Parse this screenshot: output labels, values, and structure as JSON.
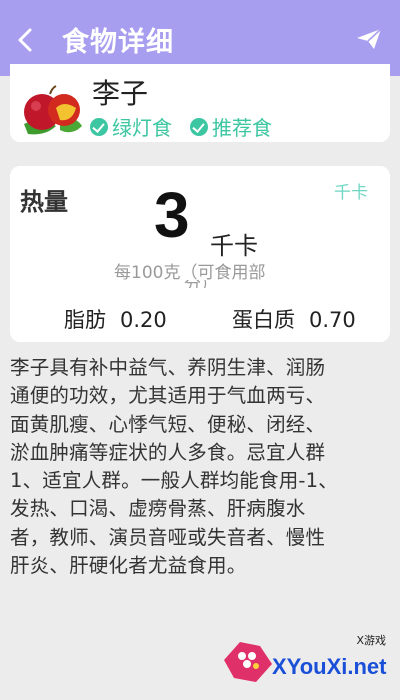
{
  "header": {
    "title": "食物详细"
  },
  "food": {
    "name": "李子",
    "tags": [
      "绿灯食",
      "推荐食"
    ]
  },
  "calories": {
    "label": "热量",
    "unit_link": "千卡",
    "value": "3",
    "unit": "千卡",
    "per": "每100克（可食用部",
    "per_overflow": "分）",
    "nutrients": [
      {
        "name": "脂肪",
        "value": "0.20"
      },
      {
        "name": "蛋白质",
        "value": "0.70"
      }
    ]
  },
  "description": {
    "lines": [
      "李子具有补中益气、养阴生津、润肠",
      "通便的功效，尤其适用于气血两亏、",
      "面黄肌瘦、心悸气短、便秘、闭经、",
      "淤血肿痛等症状的人多食。忌宜人群",
      "1、适宜人群。一般人群均能食用-1、",
      "发热、口渴、虚痨骨蒸、肝病腹水",
      "者，教师、演员音哑或失音者、慢性",
      "肝炎、肝硬化者尤益食用。"
    ]
  },
  "watermark": {
    "small": "X游戏",
    "text": "XYouXi.net"
  },
  "colors": {
    "header": "#a89ef0",
    "accent": "#3cc6a2",
    "link": "#6fd7c3"
  },
  "icons": {
    "back": "back-arrow-icon",
    "send": "send-icon",
    "tag": "check-circle-icon"
  }
}
